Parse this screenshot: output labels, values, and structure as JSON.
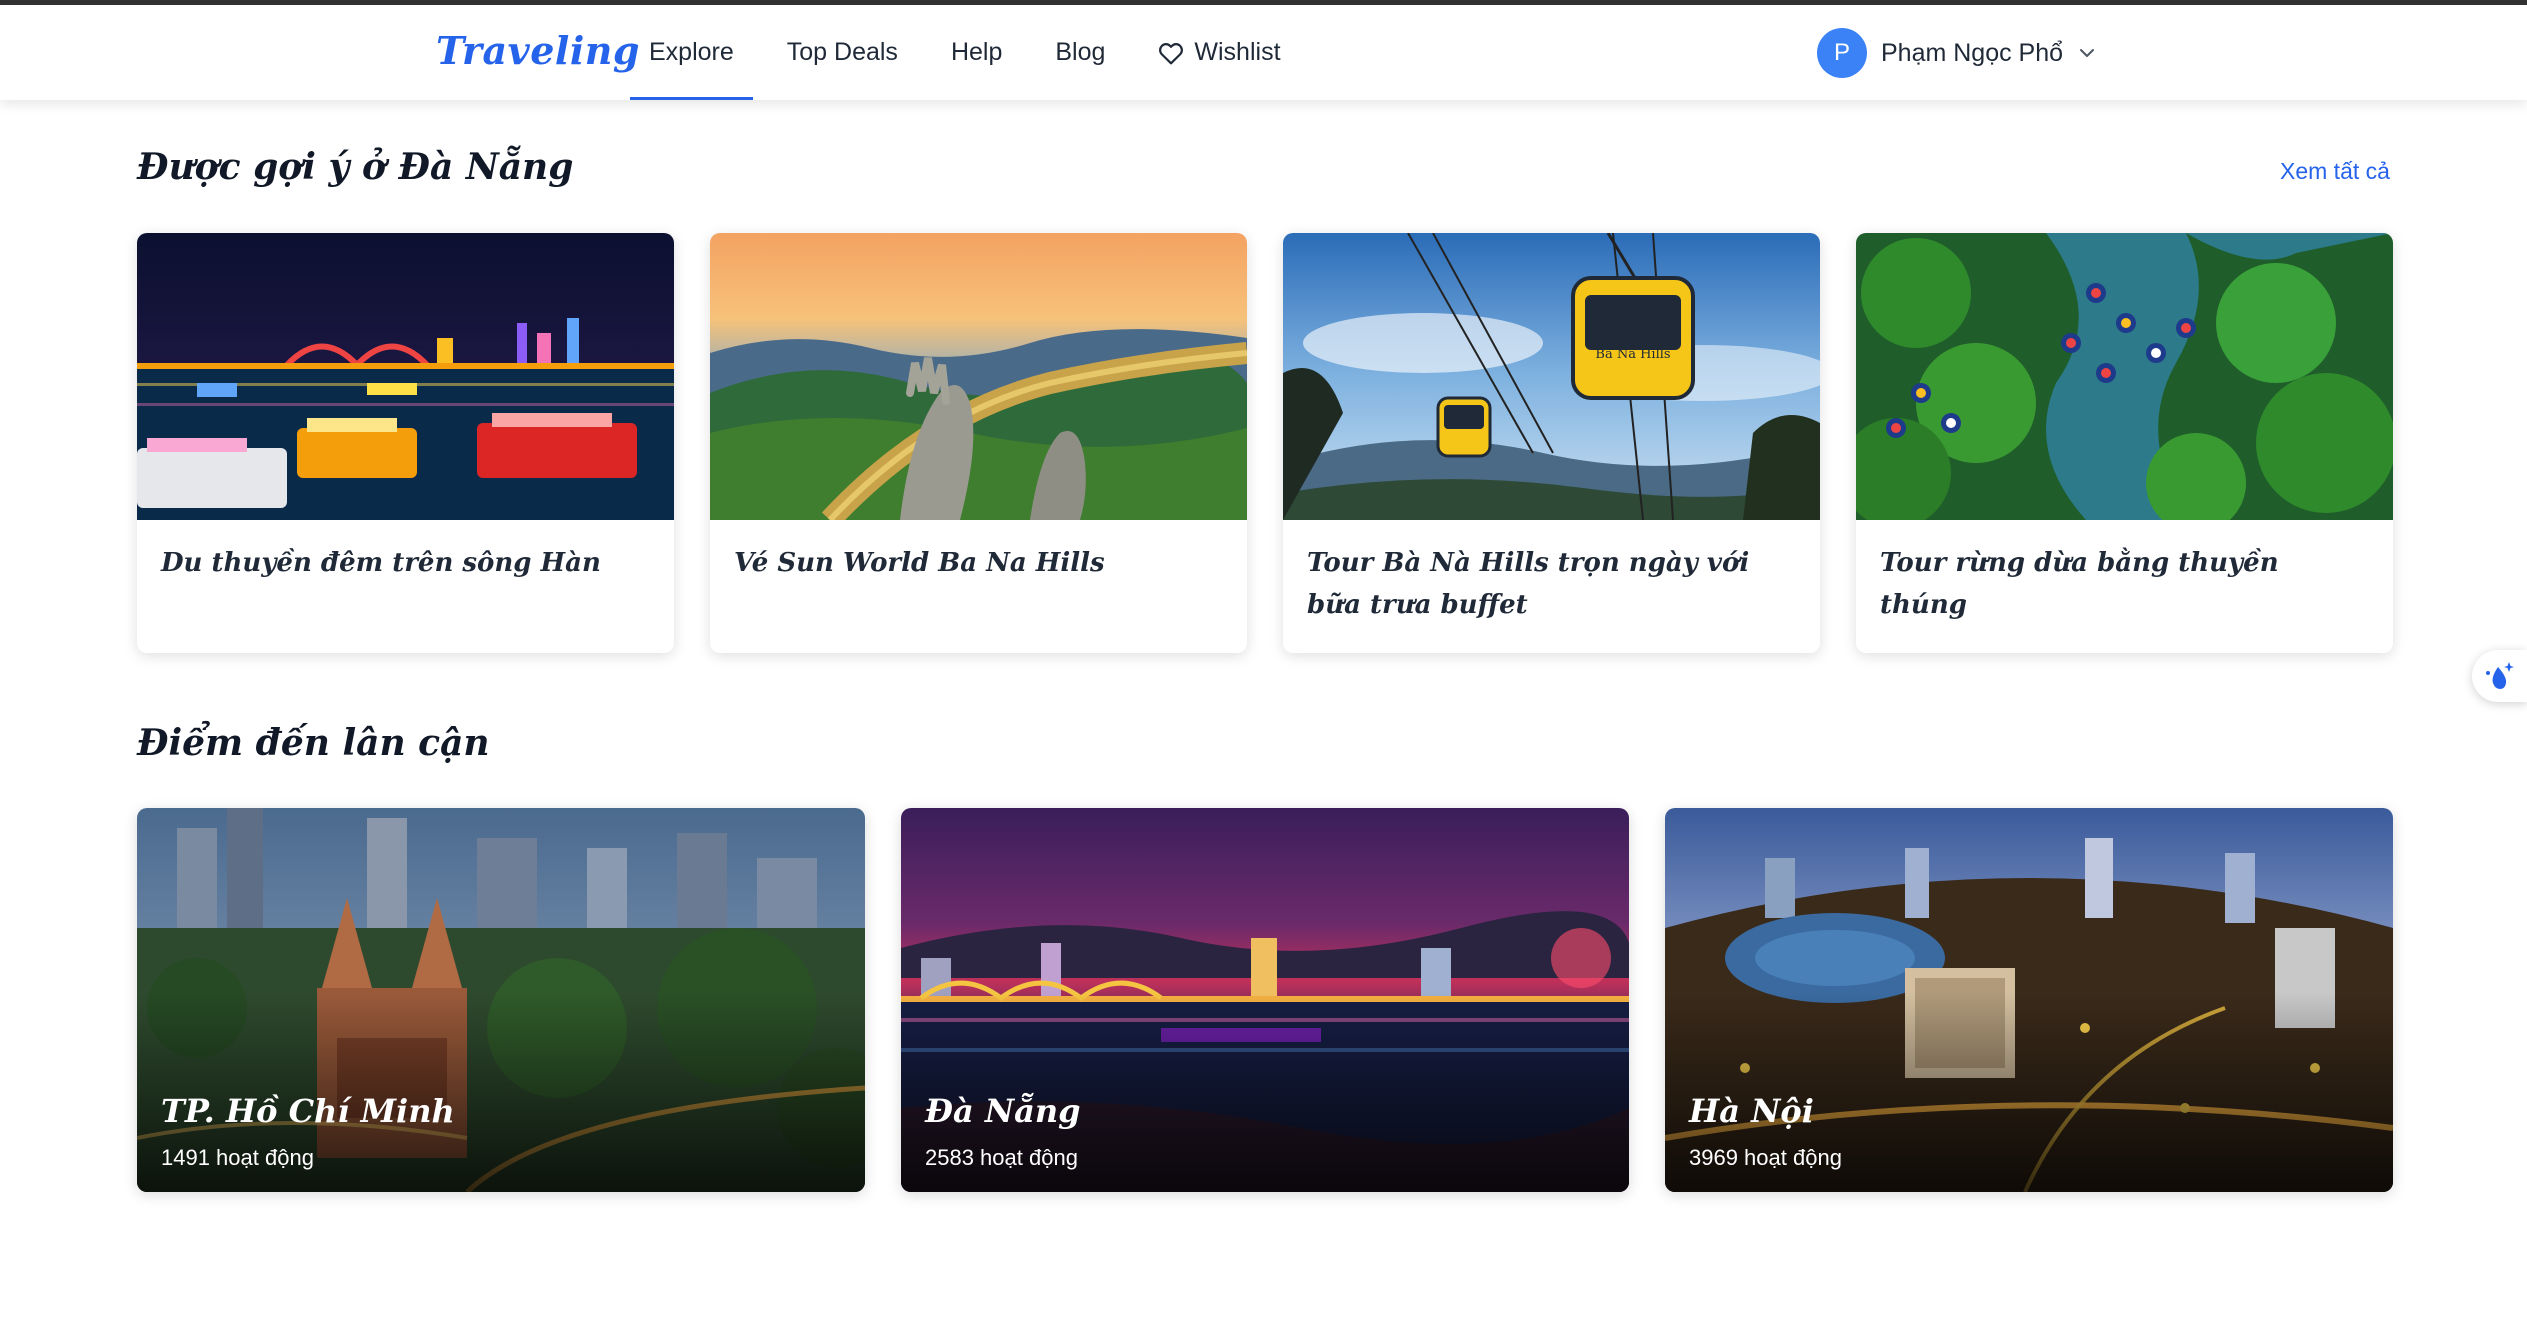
{
  "header": {
    "logo": "Traveling",
    "nav": [
      "Explore",
      "Top Deals",
      "Help",
      "Blog",
      "Wishlist"
    ],
    "active_nav": "Explore",
    "user": {
      "initial": "P",
      "name": "Phạm Ngọc Phổ"
    }
  },
  "suggested": {
    "title": "Được gợi ý ở Đà Nẵng",
    "see_all": "Xem tất cả",
    "cards": [
      {
        "title": "Du thuyền đêm trên sông Hàn"
      },
      {
        "title": "Vé Sun World Ba Na Hills"
      },
      {
        "title": "Tour Bà Nà Hills trọn ngày với bữa trưa buffet",
        "sign_text": "Ba Na Hills"
      },
      {
        "title": "Tour rừng dừa bằng thuyền thúng"
      }
    ]
  },
  "nearby": {
    "title": "Điểm đến lân cận",
    "destinations": [
      {
        "name": "TP. Hồ Chí Minh",
        "count": "1491 hoạt động"
      },
      {
        "name": "Đà Nẵng",
        "count": "2583 hoạt động"
      },
      {
        "name": "Hà Nội",
        "count": "3969 hoạt động"
      }
    ]
  },
  "colors": {
    "accent": "#2563eb",
    "avatar": "#3b82f6"
  },
  "icons": {
    "wishlist": "heart-icon",
    "user_menu": "chevron-down-icon",
    "float": "sparkle-drop-icon"
  }
}
